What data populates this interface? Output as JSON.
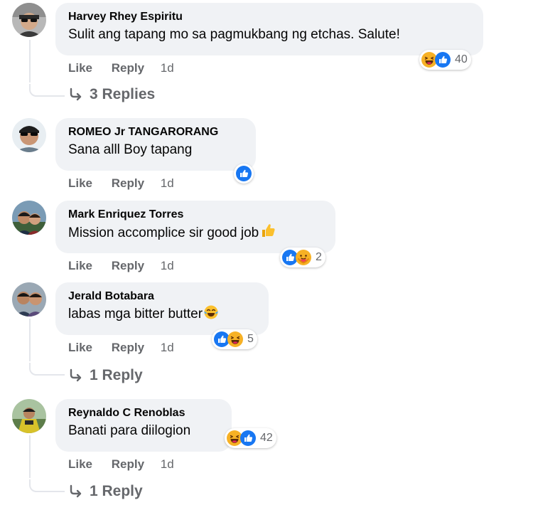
{
  "comments": [
    {
      "author": "Harvey Rhey Espiritu",
      "text": "Sulit ang tapang mo sa pagmukbang ng etchas. Salute!",
      "actions": {
        "like": "Like",
        "reply": "Reply",
        "time": "1d"
      },
      "reactions": {
        "icons": [
          "haha",
          "like"
        ],
        "count": "40"
      },
      "replies": "3 Replies"
    },
    {
      "author": "ROMEO Jr TANGARORANG",
      "text": "Sana alll Boy tapang",
      "actions": {
        "like": "Like",
        "reply": "Reply",
        "time": "1d"
      },
      "reactions": {
        "icons": [
          "like"
        ],
        "count": ""
      }
    },
    {
      "author": "Mark Enriquez Torres",
      "text": "Mission accomplice sir good job",
      "emoji": "thumbs-up",
      "actions": {
        "like": "Like",
        "reply": "Reply",
        "time": "1d"
      },
      "reactions": {
        "icons": [
          "like",
          "care"
        ],
        "count": "2"
      }
    },
    {
      "author": "Jerald Botabara",
      "text": "labas mga bitter butter",
      "emoji": "tears-of-joy",
      "actions": {
        "like": "Like",
        "reply": "Reply",
        "time": "1d"
      },
      "reactions": {
        "icons": [
          "like",
          "haha"
        ],
        "count": "5"
      },
      "replies": "1 Reply"
    },
    {
      "author": "Reynaldo C Renoblas",
      "text": "Banati para diilogion",
      "actions": {
        "like": "Like",
        "reply": "Reply",
        "time": "1d"
      },
      "reactions": {
        "icons": [
          "haha",
          "like"
        ],
        "count": "42"
      },
      "replies": "1 Reply"
    }
  ],
  "colors": {
    "bubble": "#f0f2f5",
    "meta_text": "#65676b",
    "like_blue": "#1877f2",
    "haha_yellow": "#f7b125"
  }
}
